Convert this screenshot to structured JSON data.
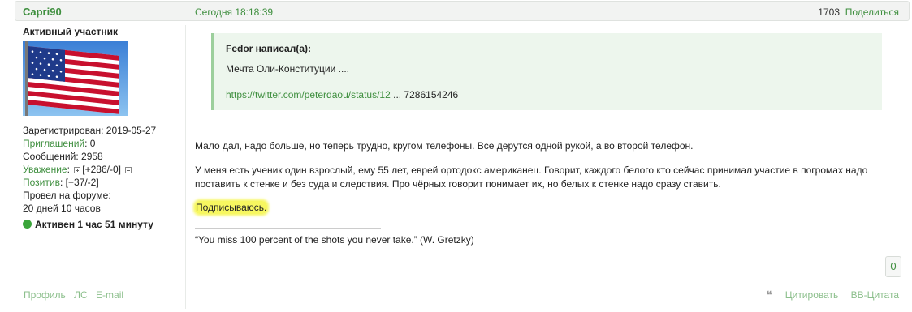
{
  "header": {
    "username": "Capri90",
    "time": "Сегодня 18:18:39",
    "post_number": "1703",
    "share_label": "Поделиться"
  },
  "user": {
    "rank": "Активный участник",
    "registered_label": "Зарегистрирован:",
    "registered_value": "2019-05-27",
    "invites_label": "Приглашений",
    "invites_value": ": 0",
    "messages_label": "Сообщений:",
    "messages_value": "2958",
    "respect_label": "Уважение",
    "respect_value": "[+286/-0]",
    "positive_label": "Позитив",
    "positive_value": "[+37/-2]",
    "time_on_forum_label": "Провел на форуме:",
    "time_on_forum_value": "20 дней 10 часов",
    "online_status": "Активен 1 час 51 минуту"
  },
  "quote": {
    "author": "Fedor написал(а):",
    "text": "Мечта Оли-Конституции ....",
    "link": "https://twitter.com/peterdaou/status/12",
    "link_suffix": "... 7286154246"
  },
  "post": {
    "p1": "Мало дал, надо больше, но теперь трудно, кругом телефоны. Все дерутся одной рукой, а во второй телефон.",
    "p2": "У меня есть ученик один взрослый, ему 55 лет, еврей ортодокс американец. Говорит, каждого белого кто сейчас принимал участие в погромах надо поставить к стенке и без суда и следствия. Про чёрных говорит понимает их, но белых к стенке надо сразу ставить.",
    "p3": "Подписываюсь.",
    "signature": "“You miss 100 percent of the shots you never take.” (W. Gretzky)"
  },
  "reactions": {
    "count": "0"
  },
  "footer": {
    "profile": "Профиль",
    "pm": "ЛС",
    "email": "E-mail",
    "quote_btn": "Цитировать",
    "bb_quote": "BB-Цитата"
  },
  "colors": {
    "accent": "#3f8f3f",
    "quote_bg": "#edf6ed",
    "highlight": "#f7f760"
  },
  "icons": {
    "online": "green-dot-icon",
    "quote": "quote-marks-icon",
    "avatar": "us-flag-avatar"
  }
}
